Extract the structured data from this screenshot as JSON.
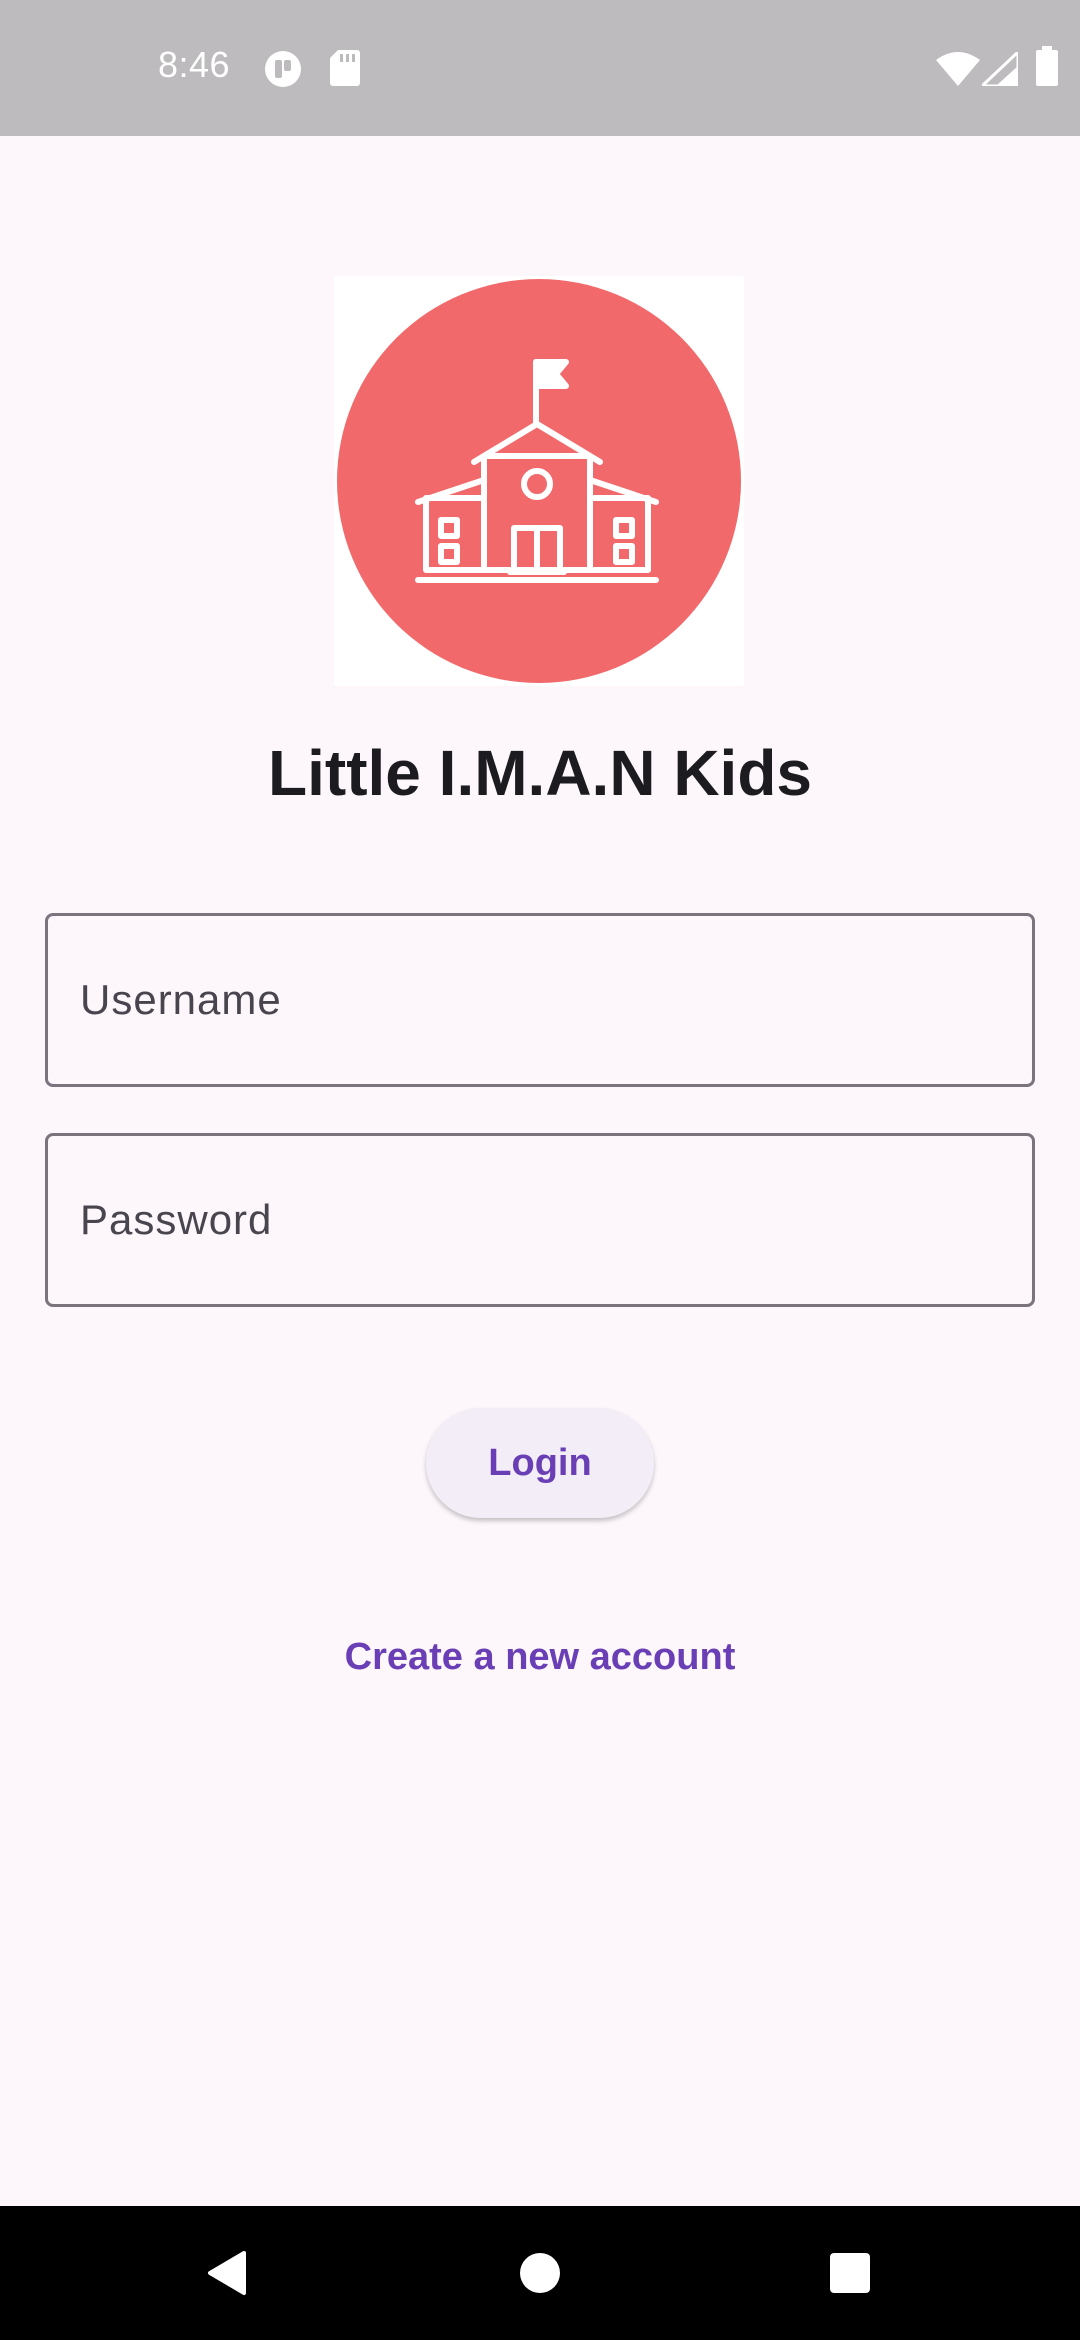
{
  "status_bar": {
    "time": "8:46",
    "icons": [
      "notification-icon",
      "sd-card-icon",
      "wifi-icon",
      "cell-signal-icon",
      "battery-icon"
    ]
  },
  "app": {
    "logo_icon": "school-building-icon",
    "title": "Little I.M.A.N Kids"
  },
  "form": {
    "username_placeholder": "Username",
    "password_placeholder": "Password",
    "login_label": "Login",
    "create_account_label": "Create a new account"
  },
  "nav_bar": {
    "icons": [
      "back-icon",
      "home-icon",
      "recents-icon"
    ]
  },
  "colors": {
    "accent": "#6a3fb5",
    "logo_circle": "#f2696b",
    "background": "#fdf7fb"
  }
}
